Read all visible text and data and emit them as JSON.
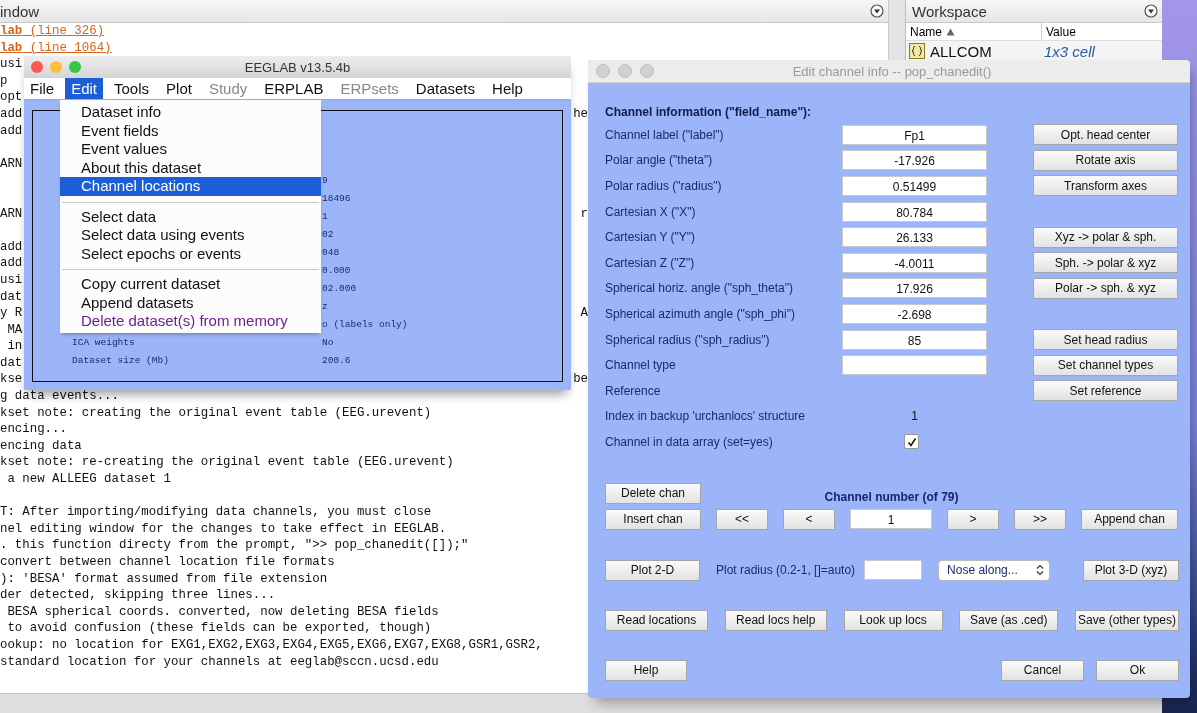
{
  "command_window": {
    "title": "indow",
    "lines": [
      {
        "kind": "link",
        "text": "**lab** (line 326)"
      },
      {
        "kind": "link",
        "text": "**lab** (line 1064)"
      },
      {
        "kind": "text",
        "text": "usi"
      },
      {
        "kind": "text",
        "text": "p"
      },
      {
        "kind": "text",
        "text": "opt"
      },
      {
        "kind": "text",
        "text": "add",
        "right": "he"
      },
      {
        "kind": "text",
        "text": "add"
      },
      {
        "kind": "blank"
      },
      {
        "kind": "text",
        "text": "ARN"
      },
      {
        "kind": "blank"
      },
      {
        "kind": "blank"
      },
      {
        "kind": "text",
        "text": "ARN",
        "right": "r"
      },
      {
        "kind": "blank"
      },
      {
        "kind": "text",
        "text": "add"
      },
      {
        "kind": "text",
        "text": "add"
      },
      {
        "kind": "text",
        "text": "usi"
      },
      {
        "kind": "text",
        "text": "dat"
      },
      {
        "kind": "text",
        "text": "y R",
        "right": "A"
      },
      {
        "kind": "text",
        "text": " MA"
      },
      {
        "kind": "text",
        "text": " in"
      },
      {
        "kind": "text",
        "text": "dat"
      },
      {
        "kind": "text",
        "text": "kse",
        "right": "be"
      },
      {
        "kind": "text",
        "text": "g data events..."
      },
      {
        "kind": "text",
        "text": "kset note: creating the original event table (EEG.urevent)"
      },
      {
        "kind": "text",
        "text": "encing..."
      },
      {
        "kind": "text",
        "text": "encing data"
      },
      {
        "kind": "text",
        "text": "kset note: re-creating the original event table (EEG.urevent)"
      },
      {
        "kind": "text",
        "text": " a new ALLEEG dataset 1"
      },
      {
        "kind": "blank"
      },
      {
        "kind": "text",
        "text": "T: After importing/modifying data channels, you must close"
      },
      {
        "kind": "text",
        "text": "nel editing window for the changes to take effect in EEGLAB."
      },
      {
        "kind": "text",
        "text": ". this function directy from the prompt, \">> pop_chanedit([]);\""
      },
      {
        "kind": "text",
        "text": "convert between channel location file formats"
      },
      {
        "kind": "text",
        "text": "): 'BESA' format assumed from file extension"
      },
      {
        "kind": "text",
        "text": "der detected, skipping three lines..."
      },
      {
        "kind": "text",
        "text": " BESA spherical coords. converted, now deleting BESA fields"
      },
      {
        "kind": "text",
        "text": " to avoid confusion (these fields can be exported, though)"
      },
      {
        "kind": "text",
        "text": "ookup: no location for EXG1,EXG2,EXG3,EXG4,EXG5,EXG6,EXG7,EXG8,GSR1,GSR2,"
      },
      {
        "kind": "text",
        "text": "standard location for your channels at eeglab@sccn.ucsd.edu"
      }
    ]
  },
  "workspace": {
    "title": "Workspace",
    "columns": [
      {
        "label": "Name",
        "sorted": true
      },
      {
        "label": "Value",
        "sorted": false
      }
    ],
    "rows": [
      {
        "name": "ALLCOM",
        "value": "1x3 cell"
      }
    ]
  },
  "eeglab": {
    "title": "EEGLAB v13.5.4b",
    "menus": [
      {
        "label": "File",
        "selected": false,
        "disabled": false
      },
      {
        "label": "Edit",
        "selected": true,
        "disabled": false
      },
      {
        "label": "Tools",
        "selected": false,
        "disabled": false
      },
      {
        "label": "Plot",
        "selected": false,
        "disabled": false
      },
      {
        "label": "Study",
        "selected": false,
        "disabled": true
      },
      {
        "label": "ERPLAB",
        "selected": false,
        "disabled": false
      },
      {
        "label": "ERPsets",
        "selected": false,
        "disabled": true
      },
      {
        "label": "Datasets",
        "selected": false,
        "disabled": false
      },
      {
        "label": "Help",
        "selected": false,
        "disabled": false
      }
    ],
    "dropdown": [
      {
        "kind": "item",
        "label": "Dataset info",
        "selected": false
      },
      {
        "kind": "item",
        "label": "Event fields",
        "selected": false
      },
      {
        "kind": "item",
        "label": "Event values",
        "selected": false
      },
      {
        "kind": "item",
        "label": "About this dataset",
        "selected": false
      },
      {
        "kind": "item",
        "label": "Channel locations",
        "selected": true
      },
      {
        "kind": "separator"
      },
      {
        "kind": "item",
        "label": "Select data",
        "selected": false
      },
      {
        "kind": "item",
        "label": "Select data using events",
        "selected": false
      },
      {
        "kind": "item",
        "label": "Select epochs or events",
        "selected": false
      },
      {
        "kind": "separator"
      },
      {
        "kind": "item",
        "label": "Copy current dataset",
        "selected": false
      },
      {
        "kind": "item",
        "label": "Append datasets",
        "selected": false
      },
      {
        "kind": "destructive",
        "label": "Delete dataset(s) from memory",
        "selected": false
      }
    ],
    "info_rows": [
      {
        "value": "9"
      },
      {
        "value": "18496"
      },
      {
        "value": "1"
      },
      {
        "value": "02"
      },
      {
        "value": "048"
      },
      {
        "value": "0.000"
      },
      {
        "value": "02.000"
      },
      {
        "value": "z"
      },
      {
        "value": "o (labels only)"
      },
      {
        "label": "ICA weights",
        "value": "No"
      },
      {
        "label": "Dataset size (Mb)",
        "value": "200.6"
      }
    ]
  },
  "chanedit": {
    "title": "Edit channel info -- pop_chanedit()",
    "header": "Channel information (\"field_name\"):",
    "rows": [
      {
        "label": "Channel label (\"label\")",
        "kind": "field",
        "value": "Fp1",
        "button": "Opt. head center"
      },
      {
        "label": "Polar angle (\"theta\")",
        "kind": "field",
        "value": "-17.926",
        "button": "Rotate axis"
      },
      {
        "label": "Polar radius (\"radius\")",
        "kind": "field",
        "value": "0.51499",
        "button": "Transform axes"
      },
      {
        "label": "Cartesian X (\"X\")",
        "kind": "field",
        "value": "80.784"
      },
      {
        "label": "Cartesian Y (\"Y\")",
        "kind": "field",
        "value": "26.133",
        "button": "Xyz -> polar & sph."
      },
      {
        "label": "Cartesian Z (\"Z\")",
        "kind": "field",
        "value": "-4.0011",
        "button": "Sph. -> polar & xyz"
      },
      {
        "label": "Spherical horiz. angle (\"sph_theta\")",
        "kind": "field",
        "value": "17.926",
        "button": "Polar -> sph. & xyz"
      },
      {
        "label": "Spherical azimuth angle (\"sph_phi\")",
        "kind": "field",
        "value": "-2.698"
      },
      {
        "label": "Spherical radius (\"sph_radius\")",
        "kind": "field",
        "value": "85",
        "button": "Set head radius"
      },
      {
        "label": "Channel type",
        "kind": "field",
        "button": "Set channel types"
      },
      {
        "label": "Reference",
        "kind": "label",
        "button": "Set reference"
      },
      {
        "label": "Index in backup 'urchanlocs' structure",
        "kind": "text",
        "value": "1"
      },
      {
        "label": "Channel in data array (set=yes)",
        "kind": "checkbox",
        "checked": true
      }
    ],
    "delete_button": "Delete chan",
    "channel_number_label": "Channel number (of 79)",
    "nav": {
      "insert": "Insert chan",
      "first": "<<",
      "prev": "<",
      "current": "1",
      "next": ">",
      "last": ">>",
      "append": "Append chan"
    },
    "plot": {
      "plot2d": "Plot 2-D",
      "radius_label": "Plot radius (0.2-1, []=auto)",
      "nose_select": "Nose along...",
      "plot3d": "Plot 3-D (xyz)"
    },
    "file_buttons": [
      "Read locations",
      "Read locs help",
      "Look up locs",
      "Save (as .ced)",
      "Save (other types)"
    ],
    "footer": {
      "help": "Help",
      "cancel": "Cancel",
      "ok": "Ok"
    }
  }
}
